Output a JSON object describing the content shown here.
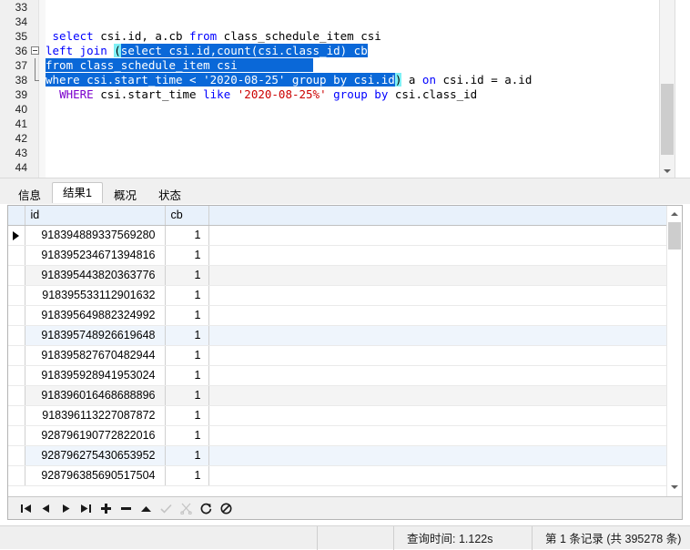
{
  "editor": {
    "first_visible_line": 33,
    "lines": [
      {
        "num": 33,
        "tokens": []
      },
      {
        "num": 34,
        "tokens": []
      },
      {
        "num": 35,
        "tokens": [
          {
            "t": " ",
            "c": "plain"
          },
          {
            "t": "select",
            "c": "kw"
          },
          {
            "t": " csi.id, a.cb ",
            "c": "plain"
          },
          {
            "t": "from",
            "c": "kw"
          },
          {
            "t": " class_schedule_item csi",
            "c": "plain"
          }
        ]
      },
      {
        "num": 36,
        "fold": "start",
        "tokens": [
          {
            "t": "left join",
            "c": "kw"
          },
          {
            "t": " ",
            "c": "plain"
          },
          {
            "t": "(",
            "c": "brhl"
          },
          {
            "t": "select csi.id,count(csi.class_id) cb",
            "c": "sel"
          }
        ]
      },
      {
        "num": 37,
        "fold": "mid",
        "tokens": [
          {
            "t": "from class_schedule_item csi           ",
            "c": "sel"
          }
        ]
      },
      {
        "num": 38,
        "fold": "end",
        "tokens": [
          {
            "t": "where csi.start_time < '2020-08-25' group by csi.id",
            "c": "sel"
          },
          {
            "t": ")",
            "c": "brhl"
          },
          {
            "t": " a ",
            "c": "plain"
          },
          {
            "t": "on",
            "c": "kw"
          },
          {
            "t": " csi.id = a.id",
            "c": "plain"
          }
        ]
      },
      {
        "num": 39,
        "tokens": [
          {
            "t": "  ",
            "c": "plain"
          },
          {
            "t": "WHERE",
            "c": "kw2"
          },
          {
            "t": " csi.start_time ",
            "c": "plain"
          },
          {
            "t": "like",
            "c": "kw"
          },
          {
            "t": " ",
            "c": "plain"
          },
          {
            "t": "'2020-08-25%'",
            "c": "str"
          },
          {
            "t": " ",
            "c": "plain"
          },
          {
            "t": "group by",
            "c": "kw"
          },
          {
            "t": " csi.class_id",
            "c": "plain"
          }
        ]
      },
      {
        "num": 40,
        "tokens": []
      },
      {
        "num": 41,
        "tokens": []
      },
      {
        "num": 42,
        "tokens": []
      },
      {
        "num": 43,
        "tokens": []
      },
      {
        "num": 44,
        "tokens": []
      }
    ]
  },
  "tabs": {
    "items": [
      {
        "label": "信息",
        "active": false
      },
      {
        "label": "结果1",
        "active": true
      },
      {
        "label": "概况",
        "active": false
      },
      {
        "label": "状态",
        "active": false
      }
    ]
  },
  "grid": {
    "columns": [
      "id",
      "cb"
    ],
    "rows": [
      {
        "id": "918394889337569280",
        "cb": "1",
        "current": true
      },
      {
        "id": "918395234671394816",
        "cb": "1",
        "current": false
      },
      {
        "id": "918395443820363776",
        "cb": "1",
        "current": false
      },
      {
        "id": "918395533112901632",
        "cb": "1",
        "current": false
      },
      {
        "id": "918395649882324992",
        "cb": "1",
        "current": false
      },
      {
        "id": "918395748926619648",
        "cb": "1",
        "current": false
      },
      {
        "id": "918395827670482944",
        "cb": "1",
        "current": false
      },
      {
        "id": "918395928941953024",
        "cb": "1",
        "current": false
      },
      {
        "id": "918396016468688896",
        "cb": "1",
        "current": false
      },
      {
        "id": "918396113227087872",
        "cb": "1",
        "current": false
      },
      {
        "id": "928796190772822016",
        "cb": "1",
        "current": false
      },
      {
        "id": "928796275430653952",
        "cb": "1",
        "current": false
      },
      {
        "id": "928796385690517504",
        "cb": "1",
        "current": false
      }
    ]
  },
  "nav_toolbar": {
    "buttons": [
      {
        "name": "first-record-icon",
        "glyph": "first",
        "disabled": false
      },
      {
        "name": "previous-record-icon",
        "glyph": "prev",
        "disabled": false
      },
      {
        "name": "next-record-icon",
        "glyph": "next",
        "disabled": false
      },
      {
        "name": "last-record-icon",
        "glyph": "last",
        "disabled": false
      },
      {
        "name": "add-record-icon",
        "glyph": "plus",
        "disabled": false
      },
      {
        "name": "delete-record-icon",
        "glyph": "minus",
        "disabled": false
      },
      {
        "name": "apply-change-icon",
        "glyph": "caret-up",
        "disabled": false
      },
      {
        "name": "confirm-icon",
        "glyph": "check",
        "disabled": true
      },
      {
        "name": "cut-icon",
        "glyph": "scissors",
        "disabled": true
      },
      {
        "name": "refresh-icon",
        "glyph": "refresh",
        "disabled": false
      },
      {
        "name": "stop-icon",
        "glyph": "cancel",
        "disabled": false
      }
    ]
  },
  "statusbar": {
    "left": "",
    "middle": "",
    "query_time": "查询时间: 1.122s",
    "record_info": "第 1 条记录 (共 395278 条)"
  },
  "colors": {
    "keyword": "#0000ff",
    "keyword_alt": "#7a00cc",
    "string": "#cc0000",
    "selection": "#0a68d8",
    "bracket_match": "#7ff0f5",
    "header_bg": "#e8f1fb"
  }
}
